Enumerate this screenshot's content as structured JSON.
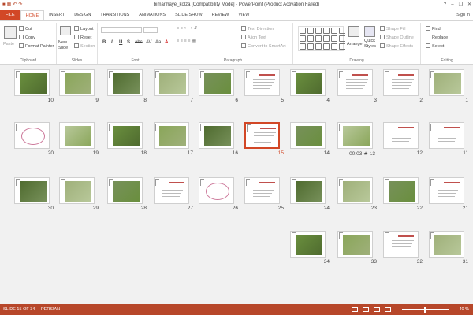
{
  "window": {
    "title": "bimarihaye_kolza [Compatibility Mode] - PowerPoint (Product Activation Failed)",
    "controls": [
      "?",
      "–",
      "❐",
      "✕"
    ]
  },
  "tabs": [
    "FILE",
    "HOME",
    "INSERT",
    "DESIGN",
    "TRANSITIONS",
    "ANIMATIONS",
    "SLIDE SHOW",
    "REVIEW",
    "VIEW"
  ],
  "active_tab": "HOME",
  "sign_in": "Sign in",
  "ribbon": {
    "clipboard": {
      "paste": "Paste",
      "cut": "Cut",
      "copy": "Copy",
      "format_painter": "Format Painter",
      "label": "Clipboard"
    },
    "slides": {
      "new_slide": "New Slide",
      "layout": "Layout",
      "reset": "Reset",
      "section": "Section",
      "label": "Slides"
    },
    "font": {
      "label": "Font",
      "buttons": [
        "B",
        "I",
        "U",
        "S",
        "abc",
        "AV",
        "Aa",
        "A"
      ]
    },
    "paragraph": {
      "label": "Paragraph",
      "text_direction": "Text Direction",
      "align_text": "Align Text",
      "convert": "Convert to SmartArt"
    },
    "drawing": {
      "label": "Drawing",
      "arrange": "Arrange",
      "quick_styles": "Quick Styles",
      "shape_fill": "Shape Fill",
      "shape_outline": "Shape Outline",
      "shape_effects": "Shape Effects"
    },
    "editing": {
      "label": "Editing",
      "find": "Find",
      "replace": "Replace",
      "select": "Select"
    }
  },
  "slides": [
    {
      "n": "10"
    },
    {
      "n": "9"
    },
    {
      "n": "8"
    },
    {
      "n": "7"
    },
    {
      "n": "6"
    },
    {
      "n": "5"
    },
    {
      "n": "4"
    },
    {
      "n": "3"
    },
    {
      "n": "2"
    },
    {
      "n": "1"
    },
    {
      "n": "20"
    },
    {
      "n": "19"
    },
    {
      "n": "18"
    },
    {
      "n": "17"
    },
    {
      "n": "16"
    },
    {
      "n": "15"
    },
    {
      "n": "14"
    },
    {
      "n": "00:03 ★ 13"
    },
    {
      "n": "12"
    },
    {
      "n": "11"
    },
    {
      "n": "30"
    },
    {
      "n": "29"
    },
    {
      "n": "28"
    },
    {
      "n": "27"
    },
    {
      "n": "26"
    },
    {
      "n": "25"
    },
    {
      "n": "24"
    },
    {
      "n": "23"
    },
    {
      "n": "22"
    },
    {
      "n": "21"
    },
    {
      "n": "34"
    },
    {
      "n": "33"
    },
    {
      "n": "32"
    },
    {
      "n": "31"
    }
  ],
  "selected_slide": "15",
  "status": {
    "slide_info": "SLIDE 15 OF 34",
    "language": "PERSIAN",
    "zoom": "40 %"
  }
}
